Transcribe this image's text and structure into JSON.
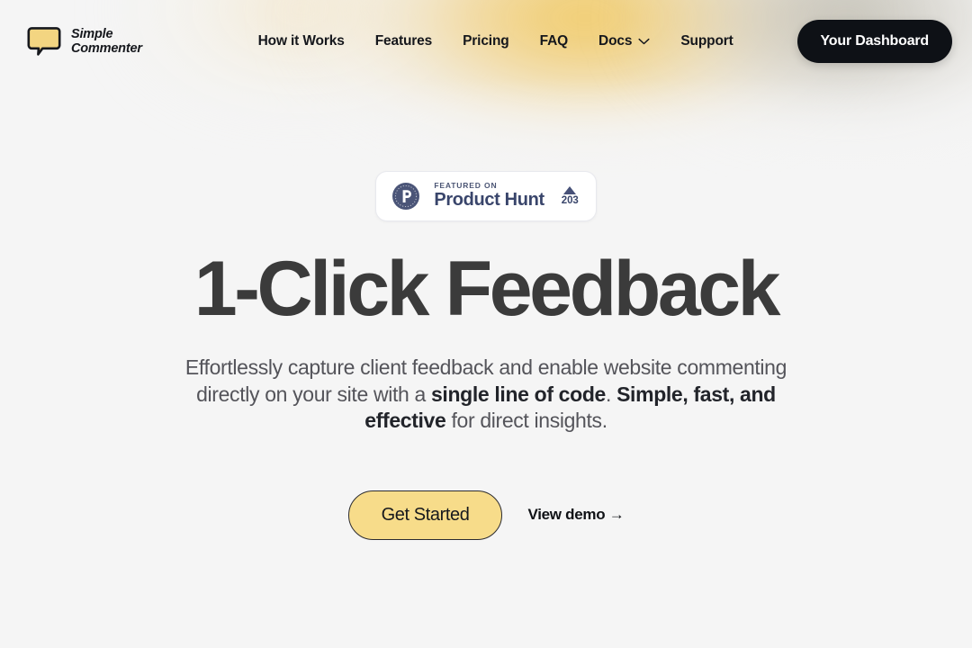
{
  "brand": {
    "icon": "speech-bubble-icon",
    "line1": "Simple",
    "line2": "Commenter",
    "bubble_fill": "#f3d581",
    "bubble_stroke": "#16181d"
  },
  "nav": {
    "items": [
      {
        "label": "How it Works",
        "has_dropdown": false
      },
      {
        "label": "Features",
        "has_dropdown": false
      },
      {
        "label": "Pricing",
        "has_dropdown": false
      },
      {
        "label": "FAQ",
        "has_dropdown": false
      },
      {
        "label": "Docs",
        "has_dropdown": true
      },
      {
        "label": "Support",
        "has_dropdown": false
      }
    ],
    "cta_label": "Your Dashboard",
    "cta_bg": "#0e1116",
    "cta_text_color": "#ffffff"
  },
  "hero": {
    "badge": {
      "logo_icon": "product-hunt-logo-icon",
      "eyebrow": "FEATURED ON",
      "name": "Product Hunt",
      "upvote_icon": "upvote-triangle-icon",
      "upvote_count": "203",
      "accent": "#39456b"
    },
    "title": "1-Click Feedback",
    "title_color": "#3b3b3b",
    "subtitle": {
      "part1": "Effortlessly capture client feedback and enable website commenting directly on your site with a ",
      "bold1": "single line of code",
      "part2": ". ",
      "bold2": "Simple, fast, and effective",
      "part3": " for direct insights."
    },
    "primary_cta": "Get Started",
    "primary_cta_bg": "#f7dc8a",
    "secondary_cta": "View demo →"
  },
  "theme": {
    "page_bg": "#f5f5f5",
    "glow_amber": "#f0c75c"
  }
}
